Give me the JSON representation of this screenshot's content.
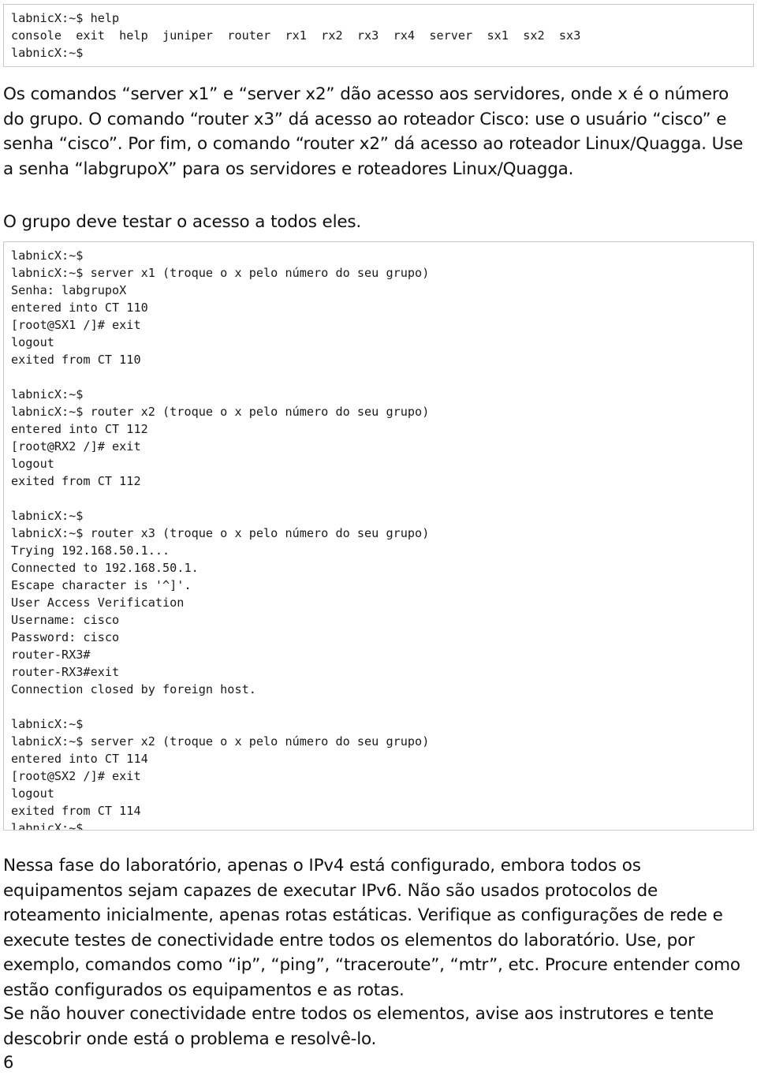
{
  "document": {
    "page_number": "6"
  },
  "terminal_help": {
    "lines": [
      "labnicX:~$ help",
      "console  exit  help  juniper  router  rx1  rx2  rx3  rx4  server  sx1  sx2  sx3",
      "labnicX:~$"
    ]
  },
  "paragraphs": {
    "intro": "Os comandos “server x1” e “server x2” dão acesso aos servidores, onde x é o número do grupo. O comando “router x3” dá acesso ao roteador Cisco: use o usuário “cisco” e senha “cisco”. Por fim, o comando “router x2” dá acesso ao roteador Linux/Quagga. Use a senha “labgrupoX” para os servidores e roteadores Linux/Quagga.",
    "testar": "O grupo deve testar o acesso a todos eles.",
    "fase": "Nessa fase do laboratório, apenas o IPv4 está configurado, embora todos os equipamentos sejam capazes de executar IPv6. Não são usados protocolos de roteamento inicialmente, apenas rotas estáticas. Verifique as configurações de rede e execute testes de conectividade entre todos os elementos do laboratório. Use, por exemplo, comandos como “ip”, “ping”, “traceroute”, “mtr”, etc. Procure entender como estão configurados os equipamentos e as rotas.",
    "conectividade": "Se não houver conectividade entre todos os elementos, avise aos instrutores e tente descobrir onde está o problema e resolvê-lo."
  },
  "terminal_session": {
    "lines": [
      "labnicX:~$",
      "labnicX:~$ server x1 (troque o x pelo número do seu grupo)",
      "Senha: labgrupoX",
      "entered into CT 110",
      "[root@SX1 /]# exit",
      "logout",
      "exited from CT 110",
      "",
      "labnicX:~$",
      "labnicX:~$ router x2 (troque o x pelo número do seu grupo)",
      "entered into CT 112",
      "[root@RX2 /]# exit",
      "logout",
      "exited from CT 112",
      "",
      "labnicX:~$",
      "labnicX:~$ router x3 (troque o x pelo número do seu grupo)",
      "Trying 192.168.50.1...",
      "Connected to 192.168.50.1.",
      "Escape character is '^]'.",
      "User Access Verification",
      "Username: cisco",
      "Password: cisco",
      "router-RX3#",
      "router-RX3#exit",
      "Connection closed by foreign host.",
      "",
      "labnicX:~$",
      "labnicX:~$ server x2 (troque o x pelo número do seu grupo)",
      "entered into CT 114",
      "[root@SX2 /]# exit",
      "logout",
      "exited from CT 114",
      "labnicX:~$"
    ]
  }
}
